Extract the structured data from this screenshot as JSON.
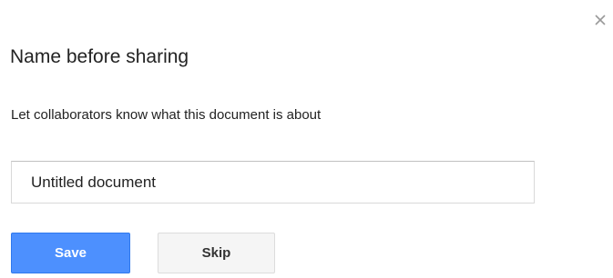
{
  "dialog": {
    "title": "Name before sharing",
    "subtitle": "Let collaborators know what this document is about",
    "close_icon": "close-icon",
    "name_input": {
      "value": "Untitled document"
    },
    "buttons": {
      "save_label": "Save",
      "skip_label": "Skip"
    },
    "colors": {
      "primary_button": "#4d90fe",
      "secondary_button": "#f5f5f5",
      "close_icon": "#999999"
    }
  }
}
